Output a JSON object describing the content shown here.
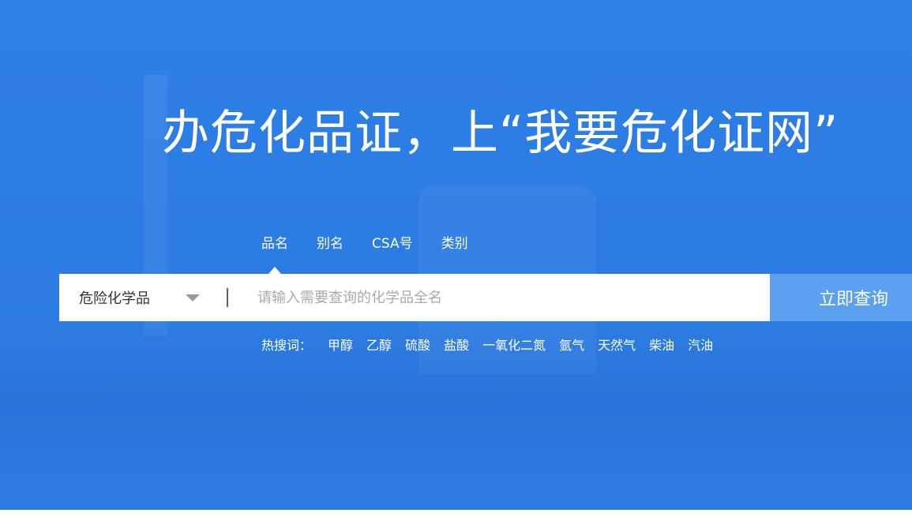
{
  "hero": {
    "headline": "办危化品证，上“我要危化证网”"
  },
  "search": {
    "tabs": [
      {
        "label": "品名"
      },
      {
        "label": "别名"
      },
      {
        "label": "CSA号"
      },
      {
        "label": "类别"
      }
    ],
    "active_tab": "品名",
    "category": "危险化学品",
    "placeholder": "请输入需要查询的化学品全名",
    "value": "",
    "button_label": "立即查询"
  },
  "hot_search": {
    "label": "热搜词：",
    "terms": [
      "甲醇",
      "乙醇",
      "硫酸",
      "盐酸",
      "一氧化二氮",
      "氩气",
      "天然气",
      "柴油",
      "汽油"
    ]
  },
  "colors": {
    "background": "#2f80e6",
    "button": "#5ca0f0",
    "text": "#ffffff"
  },
  "icons": {
    "dropdown": "caret-down-icon"
  }
}
